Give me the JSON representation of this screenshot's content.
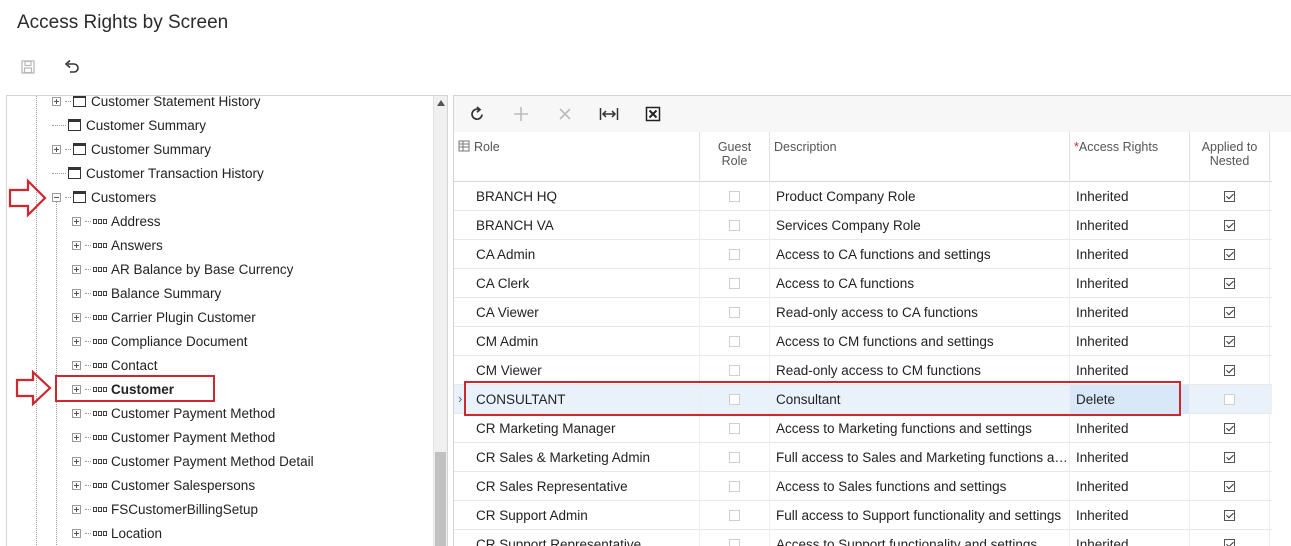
{
  "page": {
    "title": "Access Rights by Screen"
  },
  "toolbar": {
    "save_icon": "save-icon",
    "undo_icon": "undo-icon"
  },
  "tree": {
    "items": [
      {
        "label": "Customer Statement History",
        "kind": "screen",
        "expander": "plus",
        "level": 1
      },
      {
        "label": "Customer Summary",
        "kind": "screen",
        "expander": "none",
        "level": 1
      },
      {
        "label": "Customer Summary",
        "kind": "screen",
        "expander": "plus",
        "level": 1
      },
      {
        "label": "Customer Transaction History",
        "kind": "screen",
        "expander": "none",
        "level": 1
      },
      {
        "label": "Customers",
        "kind": "screen",
        "expander": "minus",
        "level": 1
      },
      {
        "label": "Address",
        "kind": "container",
        "expander": "plus",
        "level": 2
      },
      {
        "label": "Answers",
        "kind": "container",
        "expander": "plus",
        "level": 2
      },
      {
        "label": "AR Balance by Base Currency",
        "kind": "container",
        "expander": "plus",
        "level": 2
      },
      {
        "label": "Balance Summary",
        "kind": "container",
        "expander": "plus",
        "level": 2
      },
      {
        "label": "Carrier Plugin Customer",
        "kind": "container",
        "expander": "plus",
        "level": 2
      },
      {
        "label": "Compliance Document",
        "kind": "container",
        "expander": "plus",
        "level": 2
      },
      {
        "label": "Contact",
        "kind": "container",
        "expander": "plus",
        "level": 2
      },
      {
        "label": "Customer",
        "kind": "container",
        "expander": "plus",
        "level": 2,
        "bold": true
      },
      {
        "label": "Customer Payment Method",
        "kind": "container",
        "expander": "plus",
        "level": 2
      },
      {
        "label": "Customer Payment Method",
        "kind": "container",
        "expander": "plus",
        "level": 2
      },
      {
        "label": "Customer Payment Method Detail",
        "kind": "container",
        "expander": "plus",
        "level": 2
      },
      {
        "label": "Customer Salespersons",
        "kind": "container",
        "expander": "plus",
        "level": 2
      },
      {
        "label": "FSCustomerBillingSetup",
        "kind": "container",
        "expander": "plus",
        "level": 2
      },
      {
        "label": "Location",
        "kind": "container",
        "expander": "plus",
        "level": 2
      }
    ]
  },
  "grid": {
    "toolbar": [
      "refresh-icon",
      "add-icon",
      "delete-icon",
      "fit-columns-icon",
      "export-excel-icon"
    ],
    "columns": {
      "role": "Role",
      "guest_role": "Guest Role",
      "description": "Description",
      "access_rights_marker": "*",
      "access_rights": "Access Rights",
      "applied_to_nested": "Applied to Nested"
    },
    "rows": [
      {
        "role": "BRANCH HQ",
        "guest": false,
        "description": "Product Company Role",
        "access": "Inherited",
        "nested": true
      },
      {
        "role": "BRANCH VA",
        "guest": false,
        "description": "Services Company Role",
        "access": "Inherited",
        "nested": true
      },
      {
        "role": "CA Admin",
        "guest": false,
        "description": "Access to CA functions and settings",
        "access": "Inherited",
        "nested": true
      },
      {
        "role": "CA Clerk",
        "guest": false,
        "description": "Access to CA functions",
        "access": "Inherited",
        "nested": true
      },
      {
        "role": "CA Viewer",
        "guest": false,
        "description": "Read-only access to CA functions",
        "access": "Inherited",
        "nested": true
      },
      {
        "role": "CM Admin",
        "guest": false,
        "description": "Access to CM functions and settings",
        "access": "Inherited",
        "nested": true
      },
      {
        "role": "CM Viewer",
        "guest": false,
        "description": "Read-only access to CM functions",
        "access": "Inherited",
        "nested": true
      },
      {
        "role": "CONSULTANT",
        "guest": false,
        "description": "Consultant",
        "access": "Delete",
        "nested": false,
        "selected": true
      },
      {
        "role": "CR Marketing Manager",
        "guest": false,
        "description": "Access to Marketing functions and settings",
        "access": "Inherited",
        "nested": true
      },
      {
        "role": "CR Sales & Marketing Admin",
        "guest": false,
        "description": "Full access to Sales and Marketing functions and settings",
        "access": "Inherited",
        "nested": true
      },
      {
        "role": "CR Sales Representative",
        "guest": false,
        "description": "Access to Sales functions and settings",
        "access": "Inherited",
        "nested": true
      },
      {
        "role": "CR Support Admin",
        "guest": false,
        "description": "Full access to Support functionality and settings",
        "access": "Inherited",
        "nested": true
      },
      {
        "role": "CR Support Representative",
        "guest": false,
        "description": "Access to Support functionality and settings",
        "access": "Inherited",
        "nested": true
      }
    ]
  },
  "annotations": {
    "color": "#d0262d"
  }
}
